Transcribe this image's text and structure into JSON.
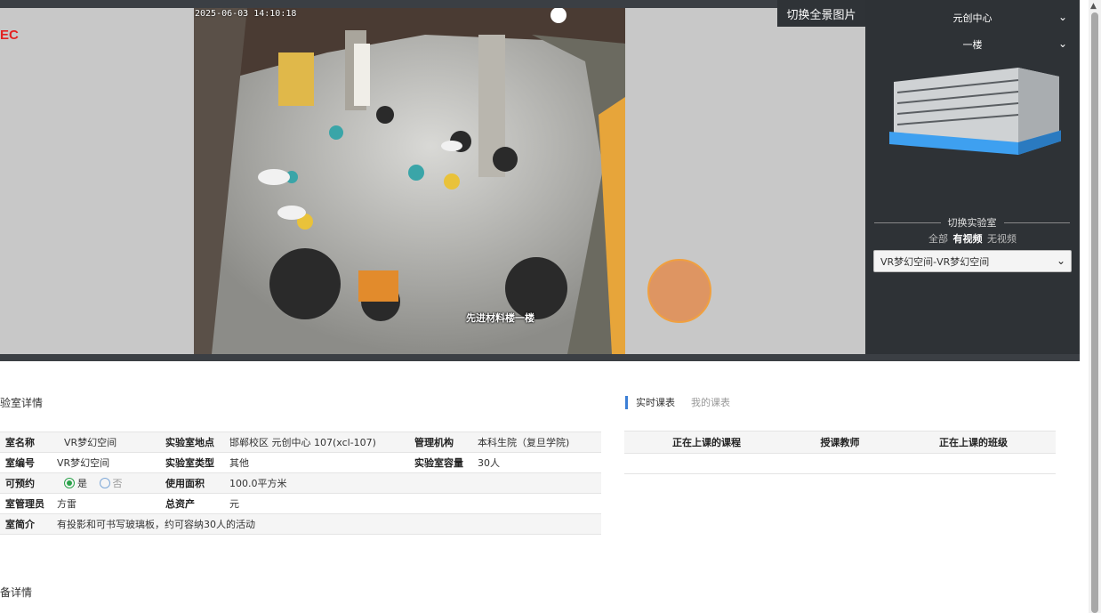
{
  "brand": {
    "text": "EC"
  },
  "video": {
    "timestamp": "2025-06-03 14:10:18",
    "camera_label": "先进材料楼一楼"
  },
  "pano_button": "切换全景图片",
  "building_selector": {
    "value": "元创中心"
  },
  "floor_selector": {
    "value": "一楼"
  },
  "switch_lab": {
    "title": "切换实验室",
    "filters": [
      {
        "label": "全部",
        "active": false
      },
      {
        "label": "有视频",
        "active": true
      },
      {
        "label": "无视频",
        "active": false
      }
    ],
    "selected": "VR梦幻空间-VR梦幻空间"
  },
  "details": {
    "section_title": "验室详情",
    "rows": {
      "name_k": "室名称",
      "name_v": "VR梦幻空间",
      "loc_k": "实验室地点",
      "loc_v": "邯郸校区 元创中心 107(xcl-107)",
      "org_k": "管理机构",
      "org_v": "本科生院（复旦学院)",
      "code_k": "室编号",
      "code_v": "VR梦幻空间",
      "type_k": "实验室类型",
      "type_v": "其他",
      "cap_k": "实验室容量",
      "cap_v": "30人",
      "book_k": "可预约",
      "book_yes": "是",
      "book_no": "否",
      "area_k": "使用面积",
      "area_v": "100.0平方米",
      "mgr_k": "室管理员",
      "mgr_v": "方雷",
      "asset_k": "总资产",
      "asset_v": "元",
      "intro_k": "室简介",
      "intro_v": "有投影和可书写玻璃板，约可容纳30人的活动"
    }
  },
  "schedule": {
    "tabs": [
      "实时课表",
      "我的课表"
    ],
    "columns": [
      "正在上课的课程",
      "授课教师",
      "正在上课的班级"
    ]
  },
  "device_section_title": "备详情",
  "colors": {
    "accent_red": "#e32222",
    "panel_dark": "#2e3236",
    "tab_blue": "#3c7fd6",
    "hotspot": "#e28c50"
  }
}
